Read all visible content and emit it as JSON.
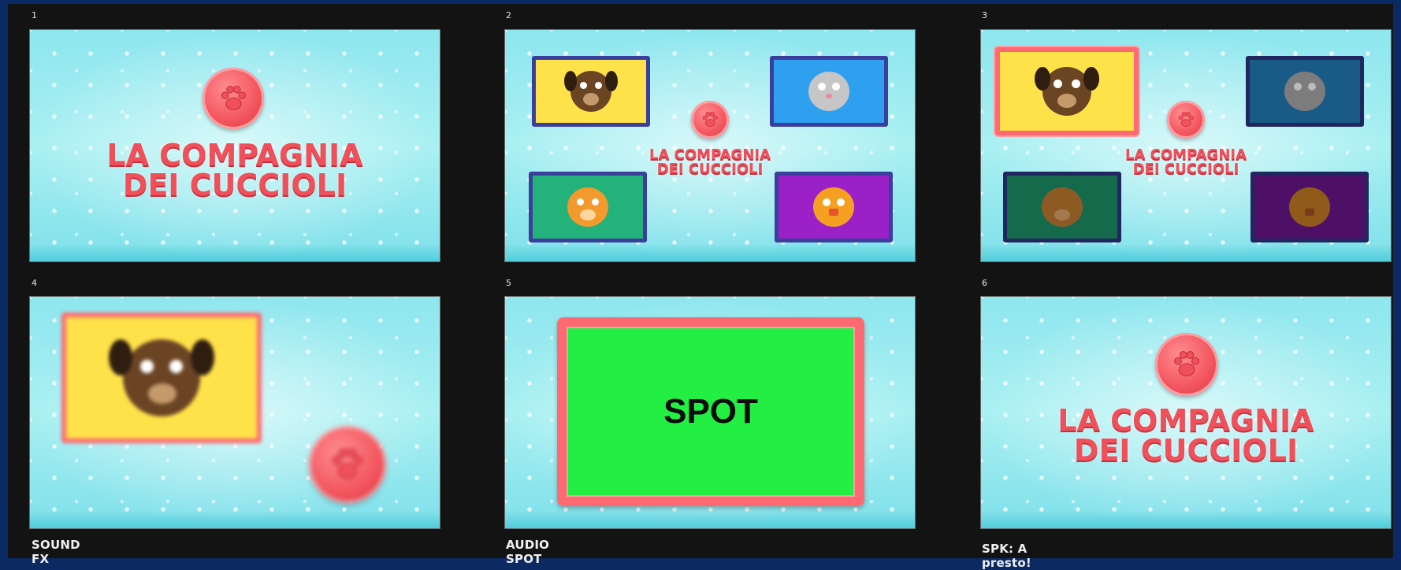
{
  "logo": {
    "line1": "LA COMPAGNIA",
    "line2": "DEI CUCCIOLI"
  },
  "spot_label": "SPOT",
  "frames": [
    {
      "number": "1",
      "caption": ""
    },
    {
      "number": "2",
      "caption": ""
    },
    {
      "number": "3",
      "caption": ""
    },
    {
      "number": "4",
      "caption": "SOUND FX"
    },
    {
      "number": "5",
      "caption": "AUDIO SPOT"
    },
    {
      "number": "6",
      "caption": "SPK: A presto!"
    }
  ],
  "icons": [
    "paw-icon",
    "dog-icon",
    "cat-icon",
    "hamster-icon",
    "chick-icon"
  ],
  "colors": {
    "background": "#0b2a63",
    "board": "#131313",
    "sky": "#a9f0f2",
    "logo_red": "#f0505a",
    "spot_green": "#22ee44"
  }
}
